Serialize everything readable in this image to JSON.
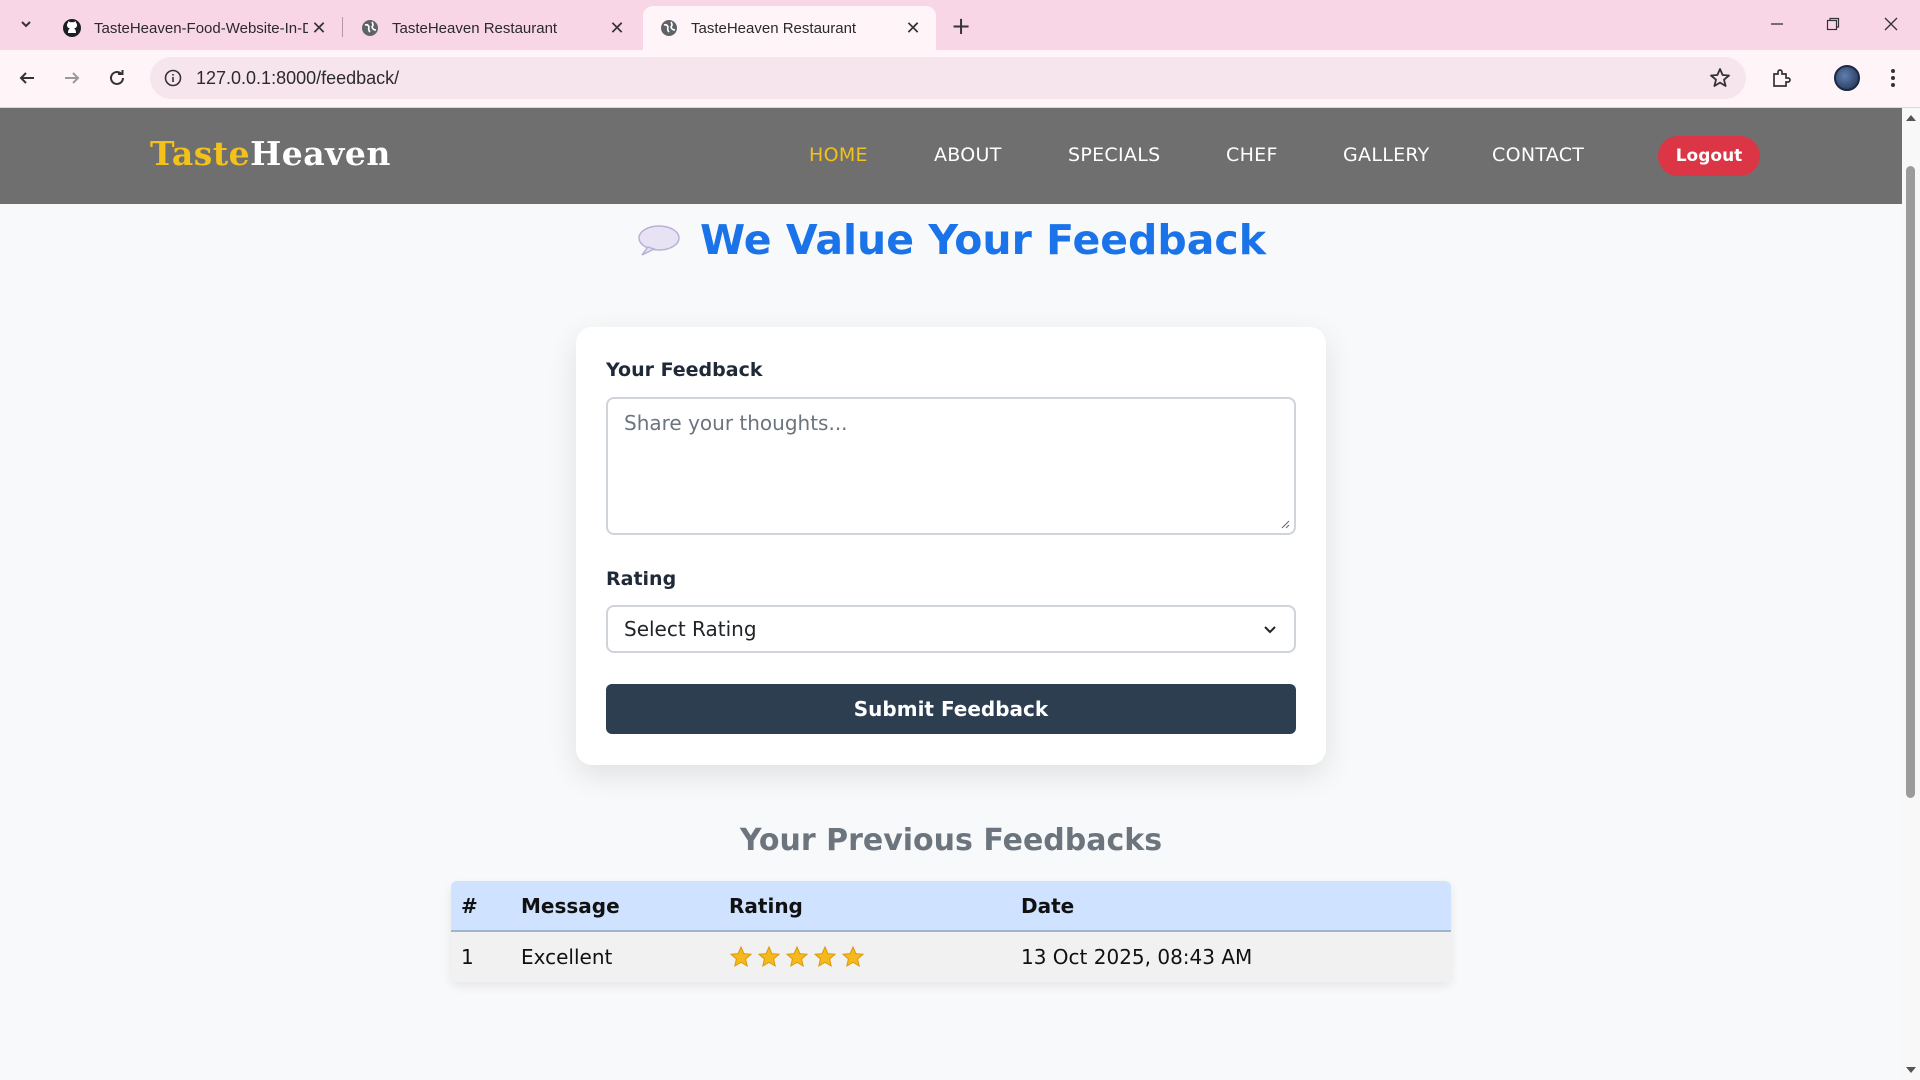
{
  "browser": {
    "tabs": [
      {
        "title": "TasteHeaven-Food-Website-In-Django",
        "icon": "github-icon"
      },
      {
        "title": "TasteHeaven Restaurant",
        "icon": "globe-icon"
      },
      {
        "title": "TasteHeaven Restaurant",
        "icon": "globe-icon",
        "active": true
      }
    ],
    "url": "127.0.0.1:8000/feedback/"
  },
  "site": {
    "logo_part1": "Taste",
    "logo_part2": "Heaven",
    "nav": [
      "HOME",
      "ABOUT",
      "SPECIALS",
      "CHEF",
      "GALLERY",
      "CONTACT"
    ],
    "active_nav": "HOME",
    "logout_label": "Logout"
  },
  "feedback": {
    "title": "We Value Your Feedback",
    "feedback_label": "Your Feedback",
    "feedback_placeholder": "Share your thoughts...",
    "rating_label": "Rating",
    "rating_selected": "Select Rating",
    "submit_label": "Submit Feedback"
  },
  "previous": {
    "title": "Your Previous Feedbacks",
    "columns": [
      "#",
      "Message",
      "Rating",
      "Date"
    ],
    "rows": [
      {
        "num": "1",
        "message": "Excellent",
        "rating": 5,
        "date": "13 Oct 2025, 08:43 AM"
      }
    ]
  },
  "colors": {
    "brand_yellow": "#f3c11b",
    "title_blue": "#1a73e8",
    "logout_red": "#dc3545",
    "submit_dark": "#2c3e50",
    "header_gray": "#6f6f6f"
  }
}
